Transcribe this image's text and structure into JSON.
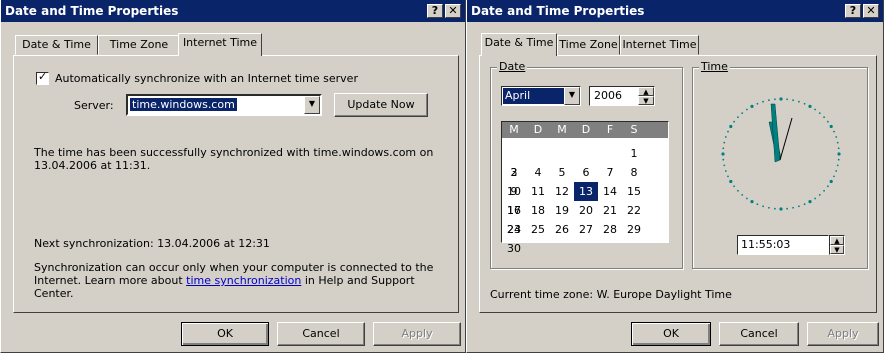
{
  "left": {
    "title": "Date and Time Properties",
    "help_btn": "?",
    "close_btn": "✕",
    "tabs": [
      "Date & Time",
      "Time Zone",
      "Internet Time"
    ],
    "auto_sync_label": "Automatically synchronize with an Internet time server",
    "server_label": "Server:",
    "server_value": "time.windows.com",
    "update_now": "Update Now",
    "success_line1": "The time has been successfully synchronized with time.windows.com on",
    "success_line2": "13.04.2006 at 11:31.",
    "next_sync": "Next synchronization: 13.04.2006 at 12:31",
    "note_line1": "Synchronization can occur only when your computer is connected to the",
    "note_line2a": "Internet.  Learn more about ",
    "note_link": "time synchronization",
    "note_line2b": " in Help and Support",
    "note_line3": "Center.",
    "ok": "OK",
    "cancel": "Cancel",
    "apply": "Apply"
  },
  "right": {
    "title": "Date and Time Properties",
    "help_btn": "?",
    "close_btn": "✕",
    "tabs": [
      "Date & Time",
      "Time Zone",
      "Internet Time"
    ],
    "date_group": "Date",
    "time_group": "Time",
    "month": "April",
    "year": "2006",
    "weekdays": [
      "M",
      "D",
      "M",
      "D",
      "F",
      "S",
      "S"
    ],
    "weeks": [
      [
        "",
        "",
        "",
        "",
        "",
        "1",
        "2"
      ],
      [
        "3",
        "4",
        "5",
        "6",
        "7",
        "8",
        "9"
      ],
      [
        "10",
        "11",
        "12",
        "13",
        "14",
        "15",
        "16"
      ],
      [
        "17",
        "18",
        "19",
        "20",
        "21",
        "22",
        "23"
      ],
      [
        "24",
        "25",
        "26",
        "27",
        "28",
        "29",
        "30"
      ]
    ],
    "selected_day": "13",
    "time_value": "11:55:03",
    "timezone_text": "Current time zone:  W. Europe Daylight Time",
    "ok": "OK",
    "cancel": "Cancel",
    "apply": "Apply"
  },
  "colors": {
    "titlebar": "#0a246a",
    "selection": "#0a246a",
    "cal_header": "#808080",
    "clock_dots": "#008080"
  }
}
